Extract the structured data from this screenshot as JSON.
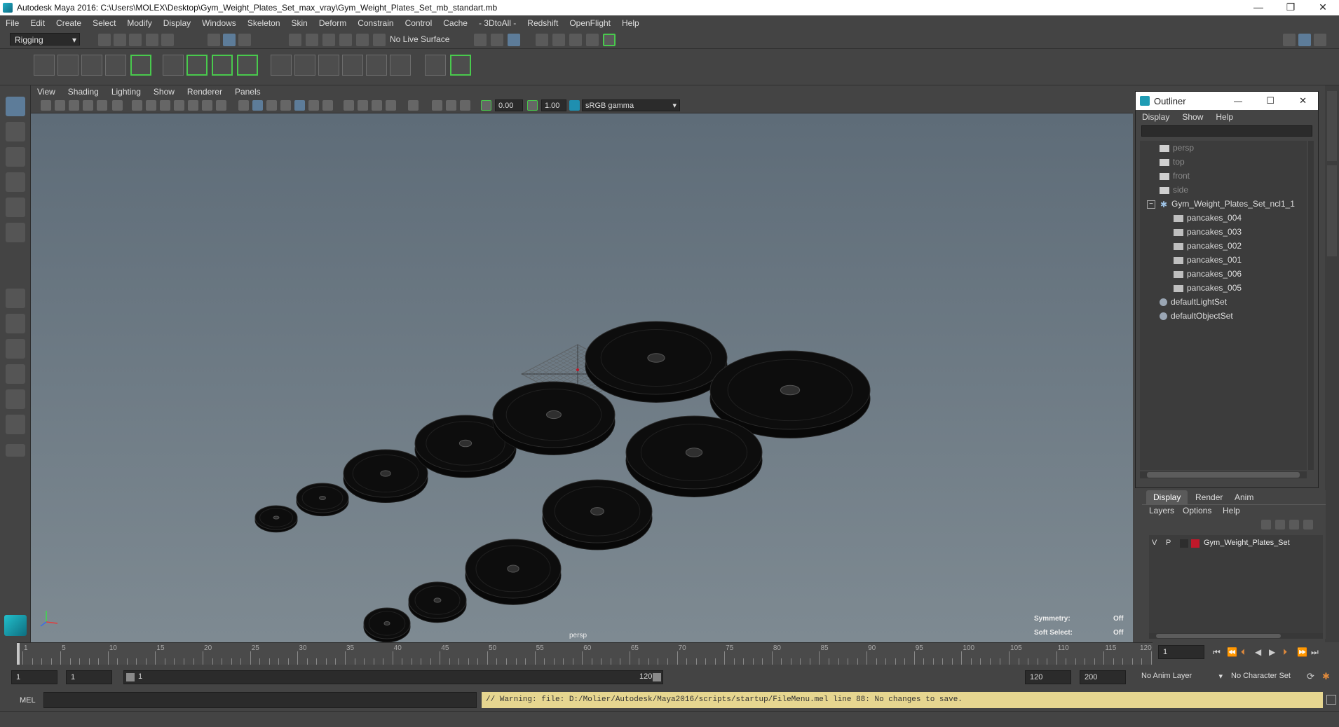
{
  "window": {
    "title": "Autodesk Maya 2016: C:\\Users\\MOLEX\\Desktop\\Gym_Weight_Plates_Set_max_vray\\Gym_Weight_Plates_Set_mb_standart.mb",
    "minimize": "—",
    "restore": "❐",
    "close": "✕"
  },
  "menubar": [
    "File",
    "Edit",
    "Create",
    "Select",
    "Modify",
    "Display",
    "Windows",
    "Skeleton",
    "Skin",
    "Deform",
    "Constrain",
    "Control",
    "Cache",
    "- 3DtoAll -",
    "Redshift",
    "OpenFlight",
    "Help"
  ],
  "statusline": {
    "mode": "Rigging",
    "live_surface": "No Live Surface"
  },
  "viewport": {
    "menu": [
      "View",
      "Shading",
      "Lighting",
      "Show",
      "Renderer",
      "Panels"
    ],
    "exposure": "0.00",
    "gamma": "1.00",
    "colorspace": "sRGB gamma",
    "camera_label": "persp",
    "symmetry_label": "Symmetry:",
    "symmetry_value": "Off",
    "soft_select_label": "Soft Select:",
    "soft_select_value": "Off"
  },
  "outliner": {
    "title": "Outliner",
    "minimize": "—",
    "restore": "☐",
    "close": "✕",
    "menu": [
      "Display",
      "Show",
      "Help"
    ],
    "cameras": [
      "persp",
      "top",
      "front",
      "side"
    ],
    "group": "Gym_Weight_Plates_Set_ncl1_1",
    "children": [
      "pancakes_004",
      "pancakes_003",
      "pancakes_002",
      "pancakes_001",
      "pancakes_006",
      "pancakes_005"
    ],
    "sets": [
      "defaultLightSet",
      "defaultObjectSet"
    ]
  },
  "layer_editor": {
    "tabs": [
      "Display",
      "Render",
      "Anim"
    ],
    "menu": [
      "Layers",
      "Options",
      "Help"
    ],
    "layer_v": "V",
    "layer_p": "P",
    "layer_name": "Gym_Weight_Plates_Set",
    "layer_color": "#c0182a"
  },
  "timeslider": {
    "labels": [
      "1",
      "5",
      "10",
      "15",
      "20",
      "25",
      "30",
      "35",
      "40",
      "45",
      "50",
      "55",
      "60",
      "65",
      "70",
      "75",
      "80",
      "85",
      "90",
      "95",
      "100",
      "105",
      "110",
      "115",
      "120"
    ],
    "current_frame": "1"
  },
  "range": {
    "start": "1",
    "playback_start": "1",
    "slider_start": "1",
    "slider_end": "120",
    "playback_end": "120",
    "end": "200",
    "anim_layer": "No Anim Layer",
    "character_set": "No Character Set"
  },
  "commandline": {
    "language": "MEL",
    "warning": "// Warning: file: D:/Molier/Autodesk/Maya2016/scripts/startup/FileMenu.mel line 88: No changes to save."
  },
  "colors": {
    "accent_green": "#49c94d",
    "warning_bg": "#e6d690"
  }
}
